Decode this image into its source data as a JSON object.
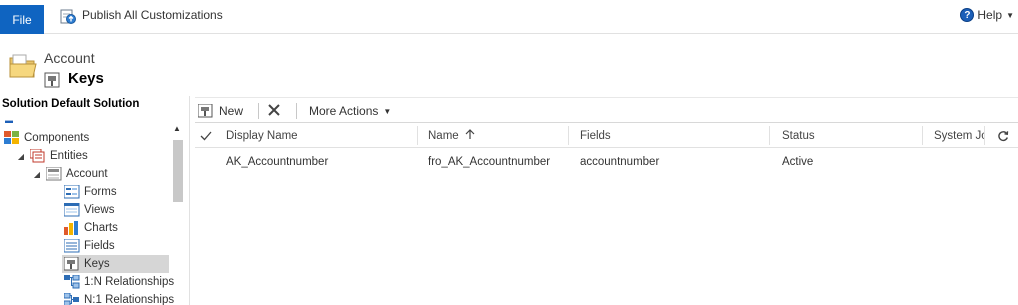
{
  "ribbon": {
    "file_label": "File",
    "publish_label": "Publish All Customizations",
    "help_label": "Help"
  },
  "header": {
    "entity_name": "Account",
    "page_title": "Keys"
  },
  "leftnav": {
    "solution_title": "Solution Default Solution",
    "items": [
      {
        "label": "Components",
        "icon": "components-icon"
      },
      {
        "label": "Entities",
        "icon": "entities-icon"
      },
      {
        "label": "Account",
        "icon": "entity-icon"
      },
      {
        "label": "Forms",
        "icon": "forms-icon"
      },
      {
        "label": "Views",
        "icon": "views-icon"
      },
      {
        "label": "Charts",
        "icon": "charts-icon"
      },
      {
        "label": "Fields",
        "icon": "fields-icon"
      },
      {
        "label": "Keys",
        "icon": "keys-icon"
      },
      {
        "label": "1:N Relationships",
        "icon": "relationship-icon"
      },
      {
        "label": "N:1 Relationships",
        "icon": "relationship-icon"
      }
    ]
  },
  "toolbar": {
    "new_label": "New",
    "more_actions_label": "More Actions"
  },
  "grid": {
    "columns": [
      "Display Name",
      "Name",
      "Fields",
      "Status",
      "System Jol"
    ],
    "sort_column": "Name",
    "rows": [
      {
        "display_name": "AK_Accountnumber",
        "name": "fro_AK_Accountnumber",
        "fields": "accountnumber",
        "status": "Active"
      }
    ]
  },
  "colors": {
    "accent": "#0f64c1",
    "selected": "#d6d6d6"
  }
}
